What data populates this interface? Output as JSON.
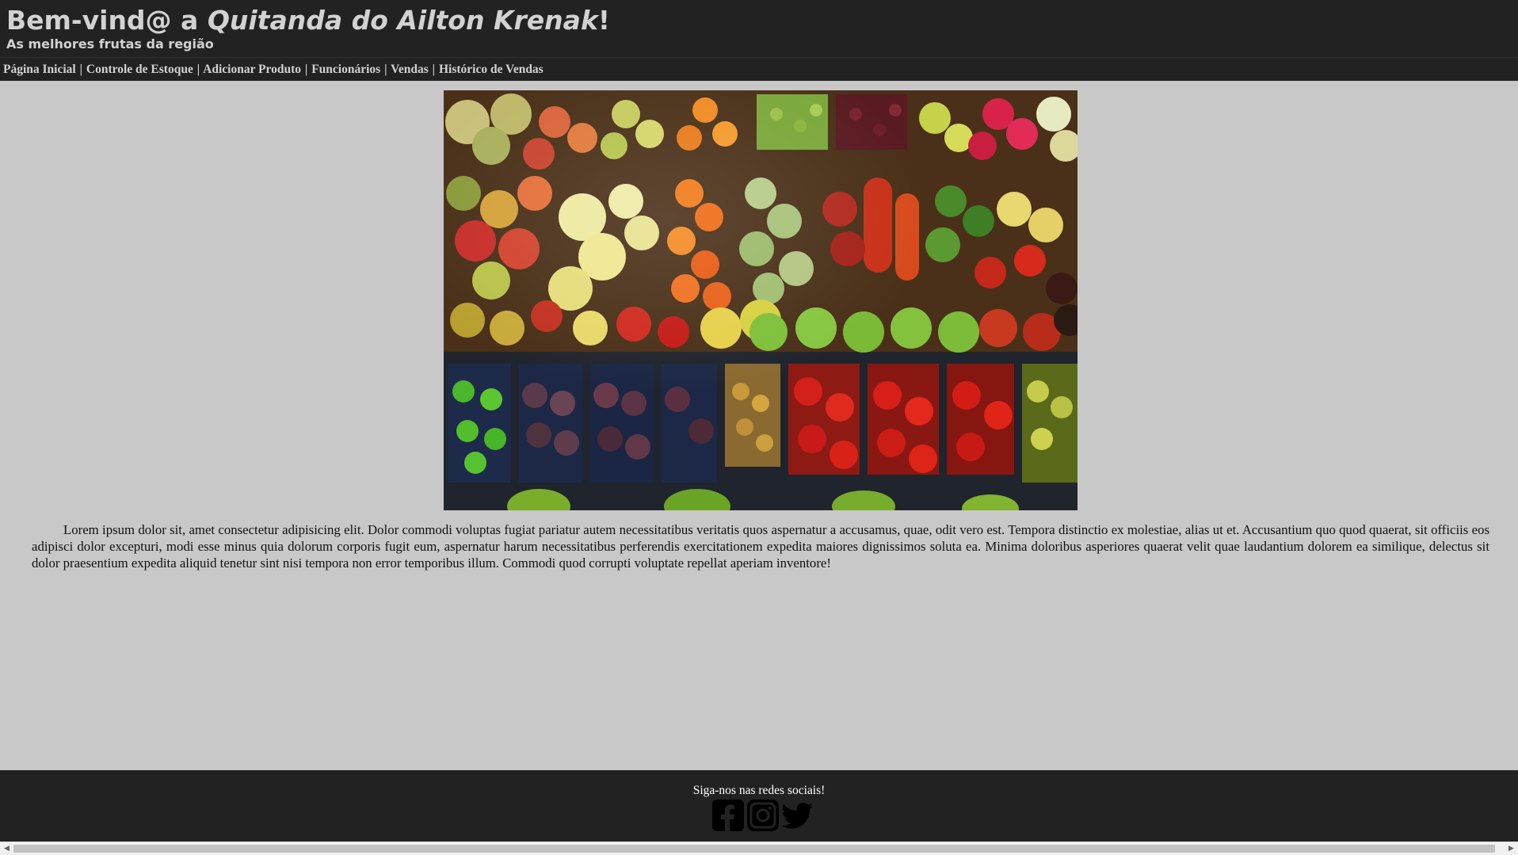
{
  "header": {
    "title_prefix": "Bem-vind@ a ",
    "title_brand": "Quitanda do Ailton Krenak",
    "title_suffix": "!",
    "subtitle": "As melhores frutas da região"
  },
  "nav": {
    "separator": "|",
    "items": [
      {
        "label": "Página Inicial"
      },
      {
        "label": "Controle de Estoque"
      },
      {
        "label": "Adicionar Produto"
      },
      {
        "label": "Funcionários"
      },
      {
        "label": "Vendas"
      },
      {
        "label": "Histórico de Vendas"
      }
    ]
  },
  "hero": {
    "icon": "fruit-market-photo"
  },
  "content": {
    "paragraph": "Lorem ipsum dolor sit, amet consectetur adipisicing elit. Dolor commodi voluptas fugiat pariatur autem necessitatibus veritatis quos aspernatur a accusamus, quae, odit vero est. Tempora distinctio ex molestiae, alias ut et. Accusantium quo quod quaerat, sit officiis eos adipisci dolor excepturi, modi esse minus quia dolorum corporis fugit eum, aspernatur harum necessitatibus perferendis exercitationem expedita maiores dignissimos soluta ea. Minima doloribus asperiores quaerat velit quae laudantium dolorem ea similique, delectus sit dolor praesentium expedita aliquid tenetur sint nisi tempora non error temporibus illum. Commodi quod corrupti voluptate repellat aperiam inventore!"
  },
  "footer": {
    "follow_text": "Siga-nos nas redes sociais!",
    "socials": [
      {
        "icon": "facebook-icon"
      },
      {
        "icon": "instagram-icon"
      },
      {
        "icon": "twitter-icon"
      }
    ]
  },
  "colors": {
    "bar_background": "#222222",
    "page_background": "#c8c8c8",
    "header_text": "#d2d2d2"
  }
}
